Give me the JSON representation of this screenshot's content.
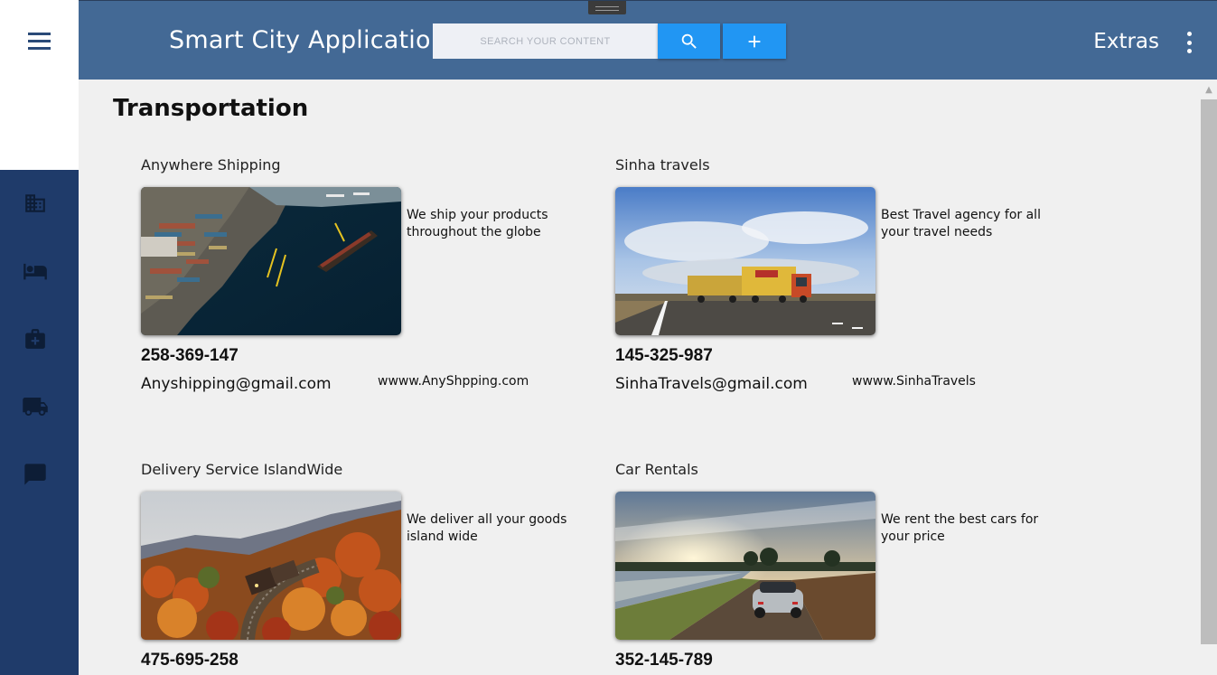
{
  "app": {
    "title": "Smart City Application",
    "search_placeholder": "SEARCH YOUR CONTENT",
    "extras_label": "Extras"
  },
  "nav": {
    "items": [
      {
        "name": "business",
        "icon": "building-icon"
      },
      {
        "name": "hotels",
        "icon": "bed-icon"
      },
      {
        "name": "health",
        "icon": "medical-bag-icon"
      },
      {
        "name": "transportation",
        "icon": "truck-icon"
      },
      {
        "name": "chat",
        "icon": "chat-bubble-icon"
      }
    ]
  },
  "page": {
    "title": "Transportation"
  },
  "cards": [
    {
      "title": "Anywhere Shipping",
      "description": "We ship your products throughout the globe",
      "phone": "258-369-147",
      "email": "Anyshipping@gmail.com",
      "website": "wwww.AnyShpping.com",
      "image": "aerial-port-photo"
    },
    {
      "title": "Sinha travels",
      "description": "Best Travel agency for all your travel needs",
      "phone": "145-325-987",
      "email": "SinhaTravels@gmail.com",
      "website": "wwww.SinhaTravels",
      "image": "truck-on-road-photo"
    },
    {
      "title": "Delivery Service IslandWide",
      "description": "We deliver all your goods island wide",
      "phone": "475-695-258",
      "email": "",
      "website": "",
      "image": "train-autumn-photo"
    },
    {
      "title": "Car Rentals",
      "description": "We rent the best cars for your price",
      "phone": "352-145-789",
      "email": "",
      "website": "",
      "image": "vintage-car-sunset-photo"
    }
  ],
  "colors": {
    "appbar": "#436995",
    "sidebar": "#1f3b6a",
    "button": "#2196f3",
    "background": "#f0f0f0"
  }
}
